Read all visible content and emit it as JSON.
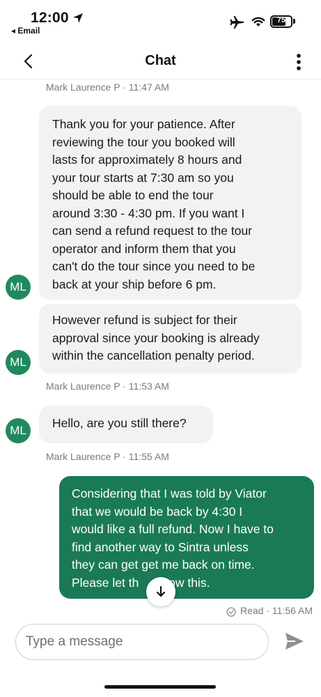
{
  "status_bar": {
    "time": "12:00",
    "back_app": "◂ Email",
    "battery": "75"
  },
  "header": {
    "title": "Chat"
  },
  "messages": [
    {
      "meta": "Mark Laurence P · 11:47 AM"
    },
    {
      "avatar": "ML",
      "lines": [
        "Thank you for your patience. After",
        "reviewing the tour you booked will",
        "lasts for approximately 8 hours and",
        "your tour starts at 7:30 am so you",
        "should be  able to end the tour",
        "around 3:30 - 4:30 pm. If you want I",
        "can send a refund request to the  tour",
        "operator and inform them that you",
        "can't do the tour since you need to be",
        "back at your ship before 6 pm."
      ]
    },
    {
      "avatar": "ML",
      "lines": [
        "However refund is subject for their",
        "approval since your booking is already",
        "within the cancellation penalty period."
      ],
      "meta": "Mark Laurence P · 11:53 AM"
    },
    {
      "avatar": "ML",
      "lines": [
        "Hello, are you still there?"
      ],
      "meta": "Mark Laurence P · 11:55 AM"
    },
    {
      "lines": [
        "Considering that I was told by Viator",
        "that we would be back by 4:30 I",
        "would like a full refund. Now I have to",
        "find another way to Sintra unless",
        "they can get get me back on time.",
        "Please let th     know this."
      ],
      "meta": "Read · 11:56 AM"
    }
  ],
  "composer": {
    "placeholder": "Type a message"
  },
  "icons": {
    "location": "location-arrow-icon",
    "airplane": "airplane-mode-icon",
    "wifi": "wifi-icon",
    "battery": "battery-icon",
    "back": "chevron-left-icon",
    "more": "more-vertical-icon",
    "scroll_down": "arrow-down-icon",
    "read": "read-check-icon",
    "send": "send-icon"
  },
  "colors": {
    "accent": "#1a7a55",
    "avatar": "#1f8a5e",
    "incoming_bubble": "#f2f2f2",
    "meta_text": "#7a7a7a"
  }
}
